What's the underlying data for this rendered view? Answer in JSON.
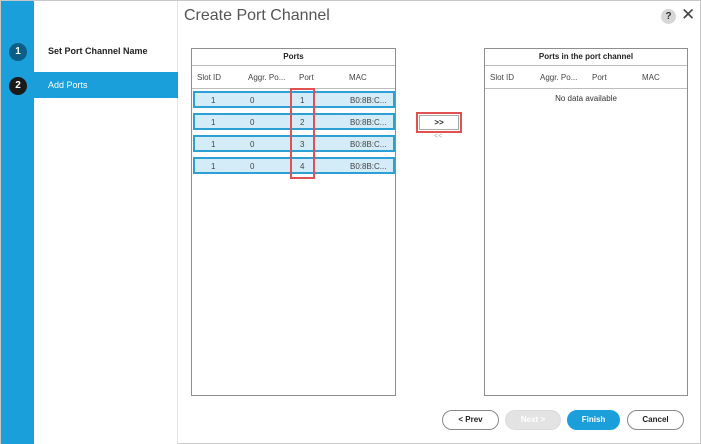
{
  "dialog": {
    "title": "Create Port Channel",
    "help_label": "?",
    "close_label": "✕"
  },
  "steps": [
    {
      "number": "1",
      "label": "Set Port Channel Name"
    },
    {
      "number": "2",
      "label": "Add Ports"
    }
  ],
  "ports_table": {
    "title": "Ports",
    "columns": [
      "Slot ID",
      "Aggr. Po...",
      "Port",
      "MAC"
    ],
    "rows": [
      {
        "slot_id": "1",
        "aggr": "0",
        "port": "1",
        "mac": "B0:8B:C..."
      },
      {
        "slot_id": "1",
        "aggr": "0",
        "port": "2",
        "mac": "B0:8B:C..."
      },
      {
        "slot_id": "1",
        "aggr": "0",
        "port": "3",
        "mac": "B0:8B:C..."
      },
      {
        "slot_id": "1",
        "aggr": "0",
        "port": "4",
        "mac": "B0:8B:C..."
      }
    ]
  },
  "channel_table": {
    "title": "Ports in the port channel",
    "columns": [
      "Slot ID",
      "Aggr. Po...",
      "Port",
      "MAC"
    ],
    "empty_text": "No data available"
  },
  "move": {
    "add_label": ">>",
    "remove_label": "<<"
  },
  "footer": {
    "prev_label": "< Prev",
    "next_label": "Next >",
    "finish_label": "Finish",
    "cancel_label": "Cancel"
  },
  "colors": {
    "accent": "#1b9fdb",
    "highlight_box": "#e05252",
    "selected_row": "#d4ecf7"
  }
}
